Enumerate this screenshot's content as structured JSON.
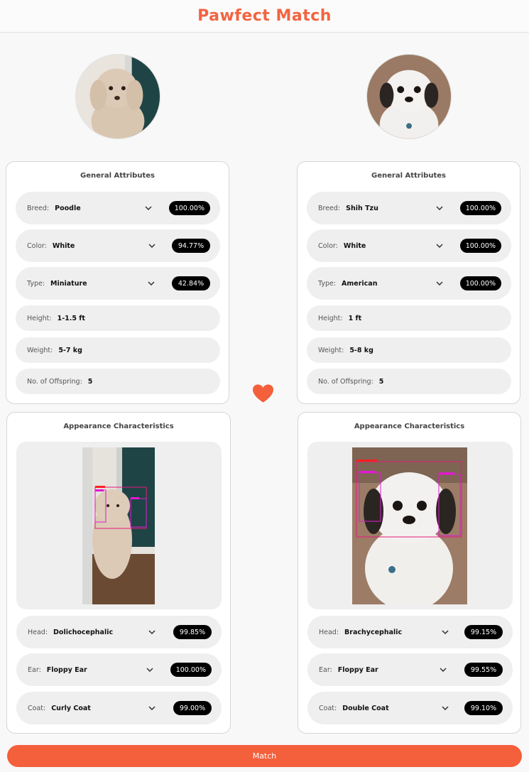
{
  "app": {
    "title": "Pawfect Match"
  },
  "colors": {
    "accent": "#f45f3c",
    "pill": "#000000",
    "row_bg": "#efefef"
  },
  "left": {
    "general": {
      "title": "General Attributes",
      "breed": {
        "label": "Breed:",
        "value": "Poodle",
        "pct": "100.00%"
      },
      "color": {
        "label": "Color:",
        "value": "White",
        "pct": "94.77%"
      },
      "type": {
        "label": "Type:",
        "value": "Miniature",
        "pct": "42.84%"
      },
      "height": {
        "label": "Height:",
        "value": "1-1.5 ft"
      },
      "weight": {
        "label": "Weight:",
        "value": "5-7 kg"
      },
      "offspring": {
        "label": "No. of Offspring:",
        "value": "5"
      }
    },
    "appearance": {
      "title": "Appearance Characteristics",
      "head": {
        "label": "Head:",
        "value": "Dolichocephalic",
        "pct": "99.85%"
      },
      "ear": {
        "label": "Ear:",
        "value": "Floppy Ear",
        "pct": "100.00%"
      },
      "coat": {
        "label": "Coat:",
        "value": "Curly Coat",
        "pct": "99.00%"
      }
    }
  },
  "right": {
    "general": {
      "title": "General Attributes",
      "breed": {
        "label": "Breed:",
        "value": "Shih Tzu",
        "pct": "100.00%"
      },
      "color": {
        "label": "Color:",
        "value": "White",
        "pct": "100.00%"
      },
      "type": {
        "label": "Type:",
        "value": "American",
        "pct": "100.00%"
      },
      "height": {
        "label": "Height:",
        "value": "1 ft"
      },
      "weight": {
        "label": "Weight:",
        "value": "5-8 kg"
      },
      "offspring": {
        "label": "No. of Offspring:",
        "value": "5"
      }
    },
    "appearance": {
      "title": "Appearance Characteristics",
      "head": {
        "label": "Head:",
        "value": "Brachycephalic",
        "pct": "99.15%"
      },
      "ear": {
        "label": "Ear:",
        "value": "Floppy Ear",
        "pct": "99.55%"
      },
      "coat": {
        "label": "Coat:",
        "value": "Double Coat",
        "pct": "99.10%"
      }
    }
  },
  "icons": {
    "dropdown": "chevron-down-icon",
    "match": "heart-icon"
  },
  "match_button": {
    "label": "Match"
  }
}
